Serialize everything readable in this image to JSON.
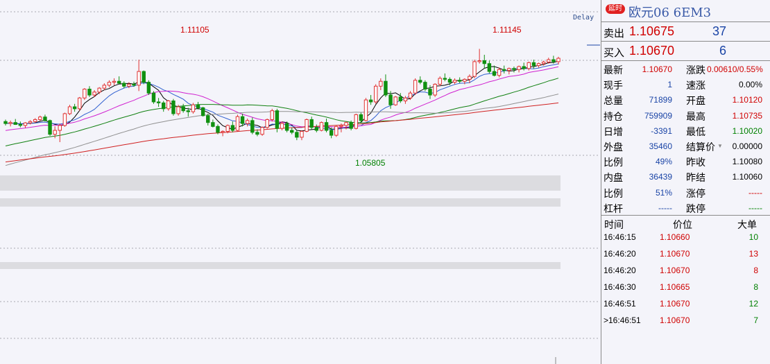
{
  "chart": {
    "delay_label": "Delay",
    "annotations": {
      "high_left": "1.11105",
      "high_right": "1.11145",
      "low": "1.05805"
    }
  },
  "colors": {
    "up": "#e03030",
    "down": "#109010",
    "ma5": "#000000",
    "ma10": "#3060d0",
    "ma20": "#d020d0",
    "ma40": "#108010",
    "ma60": "#909090",
    "ma120": "#d02020"
  },
  "chart_data": {
    "type": "candlestick",
    "title": "",
    "candles": [
      {
        "o": 1.0745,
        "h": 1.0755,
        "l": 1.0725,
        "c": 1.0735
      },
      {
        "o": 1.0735,
        "h": 1.075,
        "l": 1.072,
        "c": 1.074
      },
      {
        "o": 1.074,
        "h": 1.0758,
        "l": 1.0728,
        "c": 1.073
      },
      {
        "o": 1.073,
        "h": 1.0745,
        "l": 1.0715,
        "c": 1.0725
      },
      {
        "o": 1.0725,
        "h": 1.0742,
        "l": 1.0712,
        "c": 1.0738
      },
      {
        "o": 1.0738,
        "h": 1.0752,
        "l": 1.073,
        "c": 1.0745
      },
      {
        "o": 1.0745,
        "h": 1.0762,
        "l": 1.0738,
        "c": 1.0755
      },
      {
        "o": 1.0755,
        "h": 1.0775,
        "l": 1.0748,
        "c": 1.0768
      },
      {
        "o": 1.0768,
        "h": 1.078,
        "l": 1.0745,
        "c": 1.075
      },
      {
        "o": 1.075,
        "h": 1.0755,
        "l": 1.0672,
        "c": 1.068
      },
      {
        "o": 1.068,
        "h": 1.072,
        "l": 1.066,
        "c": 1.07
      },
      {
        "o": 1.07,
        "h": 1.0735,
        "l": 1.064,
        "c": 1.0725
      },
      {
        "o": 1.0725,
        "h": 1.079,
        "l": 1.0718,
        "c": 1.0785
      },
      {
        "o": 1.0785,
        "h": 1.083,
        "l": 1.0778,
        "c": 1.082
      },
      {
        "o": 1.082,
        "h": 1.0835,
        "l": 1.0795,
        "c": 1.081
      },
      {
        "o": 1.081,
        "h": 1.087,
        "l": 1.08,
        "c": 1.0865
      },
      {
        "o": 1.0865,
        "h": 1.0915,
        "l": 1.0855,
        "c": 1.091
      },
      {
        "o": 1.091,
        "h": 1.0925,
        "l": 1.087,
        "c": 1.088
      },
      {
        "o": 1.088,
        "h": 1.0905,
        "l": 1.087,
        "c": 1.0895
      },
      {
        "o": 1.0895,
        "h": 1.092,
        "l": 1.0885,
        "c": 1.0915
      },
      {
        "o": 1.0915,
        "h": 1.094,
        "l": 1.0905,
        "c": 1.093
      },
      {
        "o": 1.093,
        "h": 1.0955,
        "l": 1.092,
        "c": 1.0945
      },
      {
        "o": 1.0945,
        "h": 1.0965,
        "l": 1.093,
        "c": 1.095
      },
      {
        "o": 1.095,
        "h": 1.0975,
        "l": 1.0935,
        "c": 1.094
      },
      {
        "o": 1.094,
        "h": 1.095,
        "l": 1.0915,
        "c": 1.0925
      },
      {
        "o": 1.0925,
        "h": 1.0945,
        "l": 1.0915,
        "c": 1.0935
      },
      {
        "o": 1.0935,
        "h": 1.0948,
        "l": 1.0922,
        "c": 1.093
      },
      {
        "o": 1.093,
        "h": 1.106,
        "l": 1.09,
        "c": 1.1
      },
      {
        "o": 1.1,
        "h": 1.1005,
        "l": 1.0935,
        "c": 1.0945
      },
      {
        "o": 1.0945,
        "h": 1.0955,
        "l": 1.088,
        "c": 1.089
      },
      {
        "o": 1.089,
        "h": 1.09,
        "l": 1.0835,
        "c": 1.0845
      },
      {
        "o": 1.0845,
        "h": 1.0865,
        "l": 1.082,
        "c": 1.084
      },
      {
        "o": 1.084,
        "h": 1.085,
        "l": 1.0795,
        "c": 1.081
      },
      {
        "o": 1.081,
        "h": 1.0855,
        "l": 1.08,
        "c": 1.085
      },
      {
        "o": 1.085,
        "h": 1.086,
        "l": 1.0775,
        "c": 1.0785
      },
      {
        "o": 1.0785,
        "h": 1.083,
        "l": 1.0775,
        "c": 1.082
      },
      {
        "o": 1.082,
        "h": 1.0835,
        "l": 1.079,
        "c": 1.08
      },
      {
        "o": 1.08,
        "h": 1.0815,
        "l": 1.077,
        "c": 1.0795
      },
      {
        "o": 1.0795,
        "h": 1.084,
        "l": 1.0785,
        "c": 1.083
      },
      {
        "o": 1.083,
        "h": 1.0845,
        "l": 1.0805,
        "c": 1.0815
      },
      {
        "o": 1.0815,
        "h": 1.082,
        "l": 1.077,
        "c": 1.0775
      },
      {
        "o": 1.0775,
        "h": 1.0785,
        "l": 1.0725,
        "c": 1.074
      },
      {
        "o": 1.074,
        "h": 1.0755,
        "l": 1.0715,
        "c": 1.072
      },
      {
        "o": 1.072,
        "h": 1.073,
        "l": 1.068,
        "c": 1.069
      },
      {
        "o": 1.069,
        "h": 1.07,
        "l": 1.067,
        "c": 1.0695
      },
      {
        "o": 1.0695,
        "h": 1.073,
        "l": 1.0685,
        "c": 1.0725
      },
      {
        "o": 1.0725,
        "h": 1.0745,
        "l": 1.069,
        "c": 1.07
      },
      {
        "o": 1.07,
        "h": 1.078,
        "l": 1.0695,
        "c": 1.077
      },
      {
        "o": 1.077,
        "h": 1.0785,
        "l": 1.072,
        "c": 1.0735
      },
      {
        "o": 1.0735,
        "h": 1.076,
        "l": 1.072,
        "c": 1.075
      },
      {
        "o": 1.075,
        "h": 1.0765,
        "l": 1.068,
        "c": 1.069
      },
      {
        "o": 1.069,
        "h": 1.0705,
        "l": 1.067,
        "c": 1.068
      },
      {
        "o": 1.068,
        "h": 1.072,
        "l": 1.0672,
        "c": 1.0715
      },
      {
        "o": 1.0715,
        "h": 1.076,
        "l": 1.0708,
        "c": 1.0755
      },
      {
        "o": 1.0755,
        "h": 1.081,
        "l": 1.0745,
        "c": 1.08
      },
      {
        "o": 1.08,
        "h": 1.081,
        "l": 1.069,
        "c": 1.071
      },
      {
        "o": 1.071,
        "h": 1.0745,
        "l": 1.07,
        "c": 1.0735
      },
      {
        "o": 1.0735,
        "h": 1.0745,
        "l": 1.069,
        "c": 1.07
      },
      {
        "o": 1.07,
        "h": 1.0715,
        "l": 1.068,
        "c": 1.069
      },
      {
        "o": 1.069,
        "h": 1.07,
        "l": 1.065,
        "c": 1.0665
      },
      {
        "o": 1.0665,
        "h": 1.07,
        "l": 1.065,
        "c": 1.0695
      },
      {
        "o": 1.0695,
        "h": 1.076,
        "l": 1.069,
        "c": 1.0755
      },
      {
        "o": 1.0755,
        "h": 1.077,
        "l": 1.0705,
        "c": 1.0715
      },
      {
        "o": 1.0715,
        "h": 1.073,
        "l": 1.069,
        "c": 1.07
      },
      {
        "o": 1.07,
        "h": 1.0745,
        "l": 1.0695,
        "c": 1.074
      },
      {
        "o": 1.074,
        "h": 1.076,
        "l": 1.069,
        "c": 1.07
      },
      {
        "o": 1.07,
        "h": 1.0715,
        "l": 1.066,
        "c": 1.0675
      },
      {
        "o": 1.0675,
        "h": 1.0725,
        "l": 1.0667,
        "c": 1.072
      },
      {
        "o": 1.072,
        "h": 1.0735,
        "l": 1.069,
        "c": 1.0725
      },
      {
        "o": 1.0725,
        "h": 1.0745,
        "l": 1.0705,
        "c": 1.074
      },
      {
        "o": 1.074,
        "h": 1.075,
        "l": 1.07,
        "c": 1.071
      },
      {
        "o": 1.071,
        "h": 1.0785,
        "l": 1.0705,
        "c": 1.078
      },
      {
        "o": 1.078,
        "h": 1.079,
        "l": 1.074,
        "c": 1.075
      },
      {
        "o": 1.075,
        "h": 1.0865,
        "l": 1.0745,
        "c": 1.0855
      },
      {
        "o": 1.0855,
        "h": 1.088,
        "l": 1.083,
        "c": 1.0845
      },
      {
        "o": 1.0845,
        "h": 1.0935,
        "l": 1.0835,
        "c": 1.0925
      },
      {
        "o": 1.0925,
        "h": 1.0965,
        "l": 1.0905,
        "c": 1.095
      },
      {
        "o": 1.095,
        "h": 1.0985,
        "l": 1.087,
        "c": 1.088
      },
      {
        "o": 1.088,
        "h": 1.09,
        "l": 1.081,
        "c": 1.083
      },
      {
        "o": 1.083,
        "h": 1.0875,
        "l": 1.0825,
        "c": 1.087
      },
      {
        "o": 1.087,
        "h": 1.089,
        "l": 1.084,
        "c": 1.085
      },
      {
        "o": 1.085,
        "h": 1.0875,
        "l": 1.0835,
        "c": 1.0865
      },
      {
        "o": 1.0865,
        "h": 1.09,
        "l": 1.0855,
        "c": 1.089
      },
      {
        "o": 1.089,
        "h": 1.0965,
        "l": 1.088,
        "c": 1.0955
      },
      {
        "o": 1.0955,
        "h": 1.0975,
        "l": 1.0935,
        "c": 1.0945
      },
      {
        "o": 1.0945,
        "h": 1.0955,
        "l": 1.09,
        "c": 1.091
      },
      {
        "o": 1.091,
        "h": 1.093,
        "l": 1.086,
        "c": 1.088
      },
      {
        "o": 1.088,
        "h": 1.094,
        "l": 1.087,
        "c": 1.0935
      },
      {
        "o": 1.0935,
        "h": 1.0975,
        "l": 1.0925,
        "c": 1.0965
      },
      {
        "o": 1.0965,
        "h": 1.099,
        "l": 1.095,
        "c": 1.096
      },
      {
        "o": 1.096,
        "h": 1.097,
        "l": 1.093,
        "c": 1.0945
      },
      {
        "o": 1.0945,
        "h": 1.0965,
        "l": 1.0935,
        "c": 1.0955
      },
      {
        "o": 1.0955,
        "h": 1.097,
        "l": 1.094,
        "c": 1.095
      },
      {
        "o": 1.095,
        "h": 1.0965,
        "l": 1.0935,
        "c": 1.096
      },
      {
        "o": 1.096,
        "h": 1.0985,
        "l": 1.094,
        "c": 1.0975
      },
      {
        "o": 1.0975,
        "h": 1.106,
        "l": 1.0965,
        "c": 1.105
      },
      {
        "o": 1.105,
        "h": 1.1115,
        "l": 1.104,
        "c": 1.1055
      },
      {
        "o": 1.1055,
        "h": 1.1085,
        "l": 1.1015,
        "c": 1.104
      },
      {
        "o": 1.104,
        "h": 1.1055,
        "l": 1.099,
        "c": 1.1
      },
      {
        "o": 1.1,
        "h": 1.103,
        "l": 1.0975,
        "c": 1.098
      },
      {
        "o": 1.098,
        "h": 1.102,
        "l": 1.097,
        "c": 1.101
      },
      {
        "o": 1.101,
        "h": 1.103,
        "l": 1.099,
        "c": 1.1005
      },
      {
        "o": 1.1005,
        "h": 1.102,
        "l": 1.0985,
        "c": 1.1015
      },
      {
        "o": 1.1015,
        "h": 1.1025,
        "l": 1.0995,
        "c": 1.101
      },
      {
        "o": 1.101,
        "h": 1.103,
        "l": 1.0995,
        "c": 1.1025
      },
      {
        "o": 1.1025,
        "h": 1.1045,
        "l": 1.1005,
        "c": 1.1015
      },
      {
        "o": 1.1015,
        "h": 1.105,
        "l": 1.1005,
        "c": 1.1045
      },
      {
        "o": 1.1045,
        "h": 1.106,
        "l": 1.1015,
        "c": 1.103
      },
      {
        "o": 1.103,
        "h": 1.1045,
        "l": 1.102,
        "c": 1.104
      },
      {
        "o": 1.104,
        "h": 1.1055,
        "l": 1.103,
        "c": 1.1048
      },
      {
        "o": 1.1048,
        "h": 1.107,
        "l": 1.104,
        "c": 1.106
      },
      {
        "o": 1.106,
        "h": 1.108,
        "l": 1.104,
        "c": 1.105
      },
      {
        "o": 1.105,
        "h": 1.1075,
        "l": 1.1035,
        "c": 1.1067
      }
    ],
    "moving_averages": [
      {
        "name": "MA5",
        "color": "#000000"
      },
      {
        "name": "MA10",
        "color": "#3060d0"
      },
      {
        "name": "MA20",
        "color": "#d020d0"
      },
      {
        "name": "MA40",
        "color": "#108010"
      },
      {
        "name": "MA60",
        "color": "#909090"
      },
      {
        "name": "MA120",
        "color": "#d02020"
      }
    ]
  },
  "panel": {
    "badge": "延时",
    "title": "欧元06  6EM3",
    "sell": {
      "label": "卖出",
      "price": "1.10675",
      "volume": "37"
    },
    "buy": {
      "label": "买入",
      "price": "1.10670",
      "volume": "6"
    },
    "stats_left": [
      {
        "label": "最新",
        "value": "1.10670",
        "color": "red"
      },
      {
        "label": "现手",
        "value": "1",
        "color": "blue"
      },
      {
        "label": "总量",
        "value": "71899",
        "color": "blue"
      },
      {
        "label": "持仓",
        "value": "759909",
        "color": "blue"
      },
      {
        "label": "日增",
        "value": "-3391",
        "color": "blue"
      },
      {
        "label": "外盘",
        "value": "35460",
        "color": "blue"
      },
      {
        "label": "比例",
        "value": "49%",
        "color": "blue"
      },
      {
        "label": "内盘",
        "value": "36439",
        "color": "blue"
      },
      {
        "label": "比例",
        "value": "51%",
        "color": "blue"
      },
      {
        "label": "杠杆",
        "value": "-----",
        "color": "blue"
      }
    ],
    "stats_right": [
      {
        "label": "涨跌",
        "value": "0.00610/0.55%",
        "color": "red"
      },
      {
        "label": "速涨",
        "value": "0.00%",
        "color": "black"
      },
      {
        "label": "开盘",
        "value": "1.10120",
        "color": "red"
      },
      {
        "label": "最高",
        "value": "1.10735",
        "color": "red"
      },
      {
        "label": "最低",
        "value": "1.10020",
        "color": "green"
      },
      {
        "label": "结算价",
        "value": "0.00000",
        "color": "black"
      },
      {
        "label": "昨收",
        "value": "1.10080",
        "color": "black"
      },
      {
        "label": "昨结",
        "value": "1.10060",
        "color": "black"
      },
      {
        "label": "涨停",
        "value": "-----",
        "color": "red"
      },
      {
        "label": "跌停",
        "value": "-----",
        "color": "green"
      }
    ],
    "ticks_header": {
      "time": "时间",
      "price": "价位",
      "size": "大单"
    },
    "ticks": [
      {
        "time": "16:46:15",
        "price": "1.10660",
        "size": "10",
        "size_color": "green"
      },
      {
        "time": "16:46:20",
        "price": "1.10670",
        "size": "13",
        "size_color": "red"
      },
      {
        "time": "16:46:20",
        "price": "1.10670",
        "size": "8",
        "size_color": "red"
      },
      {
        "time": "16:46:30",
        "price": "1.10665",
        "size": "8",
        "size_color": "green"
      },
      {
        "time": "16:46:51",
        "price": "1.10670",
        "size": "12",
        "size_color": "green"
      },
      {
        "time": ">16:46:51",
        "price": "1.10670",
        "size": "7",
        "size_color": "green"
      }
    ]
  }
}
